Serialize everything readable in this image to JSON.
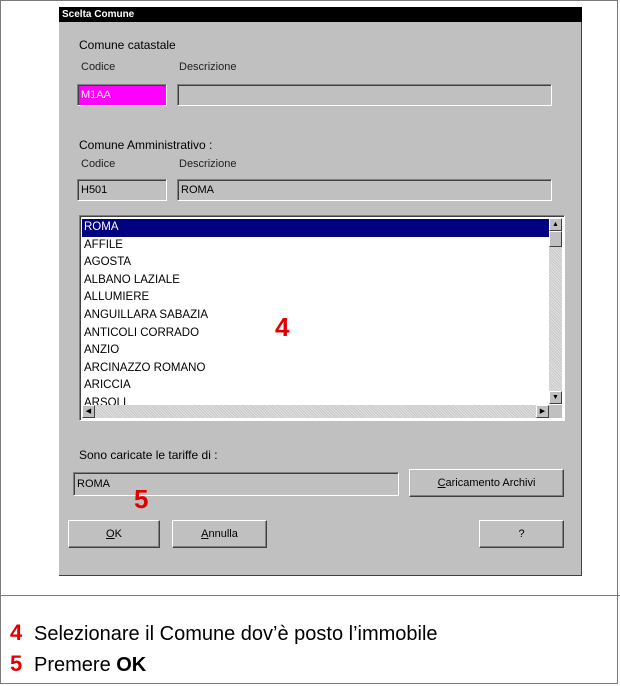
{
  "dialog": {
    "title": "Scelta Comune",
    "catastale": {
      "section_label": "Comune catastale",
      "codice_label": "Codice",
      "descrizione_label": "Descrizione",
      "codice_value": "M1AA",
      "descrizione_value": ""
    },
    "amministrativo": {
      "section_label": "Comune Amministrativo :",
      "codice_label": "Codice",
      "descrizione_label": "Descrizione",
      "codice_value": "H501",
      "descrizione_value": "ROMA"
    },
    "list": {
      "items": [
        "ROMA",
        "AFFILE",
        "AGOSTA",
        "ALBANO LAZIALE",
        "ALLUMIERE",
        "ANGUILLARA SABAZIA",
        "ANTICOLI CORRADO",
        "ANZIO",
        "ARCINAZZO ROMANO",
        "ARICCIA",
        "ARSOLI"
      ],
      "selected": "ROMA"
    },
    "tariffe": {
      "label": "Sono caricate le tariffe di :",
      "value": "ROMA",
      "button_label": "Caricamento Archivi"
    },
    "buttons": {
      "ok": "OK",
      "annulla": "Annulla",
      "help": "?"
    }
  },
  "markers": {
    "four": "4",
    "five": "5"
  },
  "captions": [
    {
      "num": "4",
      "text": "Selezionare il Comune dov’è posto l’immobile"
    },
    {
      "num": "5",
      "text_before": "Premere ",
      "bold": "OK"
    }
  ],
  "colors": {
    "highlight": "#000080",
    "magenta_field": "#ff00ff",
    "marker": "#e00000"
  }
}
